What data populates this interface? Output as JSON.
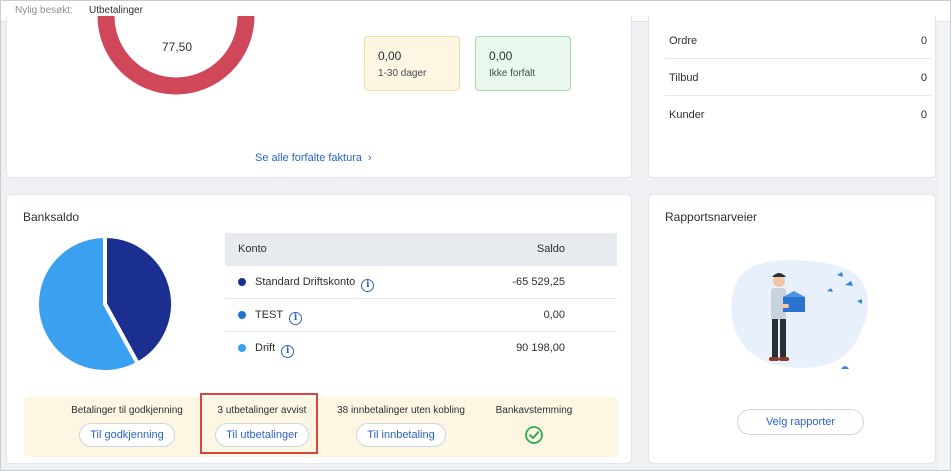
{
  "recent": {
    "label": "Nylig besøkt:",
    "link": "Utbetalinger"
  },
  "overdue": {
    "donut_value": "77,50",
    "boxes": [
      {
        "value": "0,00",
        "label": "1-30 dager"
      },
      {
        "value": "0,00",
        "label": "Ikke forfalt"
      }
    ],
    "see_all": "Se alle forfalte faktura"
  },
  "counts": [
    {
      "label": "Ordre",
      "value": "0"
    },
    {
      "label": "Tilbud",
      "value": "0"
    },
    {
      "label": "Kunder",
      "value": "0"
    }
  ],
  "bank": {
    "title": "Banksaldo",
    "headers": {
      "account": "Konto",
      "balance": "Saldo"
    },
    "rows": [
      {
        "name": "Standard Driftskonto",
        "amount": "-65 529,25",
        "color": "#1a2f8f"
      },
      {
        "name": "TEST",
        "amount": "0,00",
        "color": "#1f75d1"
      },
      {
        "name": "Drift",
        "amount": "90 198,00",
        "color": "#3aa0f0"
      }
    ],
    "pie_shares": {
      "Standard Driftskonto": 0.42,
      "Drift": 0.58
    },
    "actions": [
      {
        "text": "Betalinger til godkjenning",
        "button": "Til godkjenning"
      },
      {
        "text": "3 utbetalinger avvist",
        "button": "Til utbetalinger"
      },
      {
        "text": "38 innbetalinger uten kobling",
        "button": "Til innbetaling"
      },
      {
        "text": "Bankavstemming",
        "icon": "check-circle-icon"
      }
    ]
  },
  "reports": {
    "title": "Rapportsnarveier",
    "button": "Velg rapporter"
  },
  "colors": {
    "accent": "#2b64c8",
    "donut": "#cf4759",
    "highlight": "#d9443c",
    "success": "#2eaa4f"
  }
}
